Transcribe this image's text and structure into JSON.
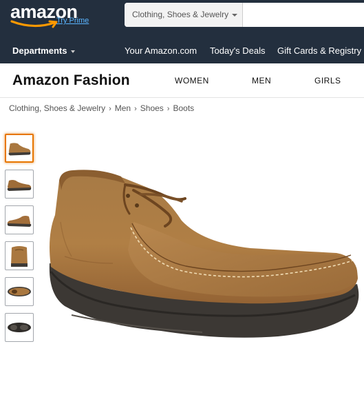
{
  "header": {
    "logo_text": "amazon",
    "prime_text": "Try Prime",
    "search": {
      "category": "Clothing, Shoes & Jewelry",
      "placeholder": ""
    },
    "departments_label": "Departments",
    "nav_links": [
      "Your Amazon.com",
      "Today's Deals",
      "Gift Cards & Registry"
    ]
  },
  "fashion": {
    "title": "Amazon Fashion",
    "categories": [
      "WOMEN",
      "MEN",
      "GIRLS"
    ]
  },
  "breadcrumb": [
    "Clothing, Shoes & Jewelry",
    "Men",
    "Shoes",
    "Boots"
  ],
  "gallery": {
    "thumbnails": [
      "side view",
      "side view",
      "side view",
      "back view",
      "top view",
      "sole view"
    ],
    "selected_index": 0
  },
  "colors": {
    "nav_bg": "#232f3e",
    "accent": "#ff9900",
    "prime_link": "#5ab5ff",
    "thumb_selected": "#e77600",
    "shoe_leather": "#a9773f",
    "shoe_sole": "#3e3a36"
  }
}
